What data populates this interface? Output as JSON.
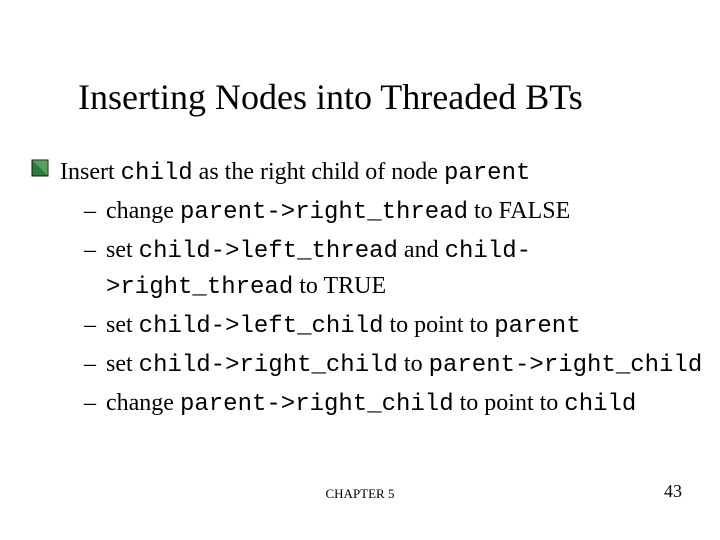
{
  "title": "Inserting Nodes into Threaded BTs",
  "lvl1": {
    "pre": "Insert ",
    "code1": "child",
    "mid": " as the right child of node ",
    "code2": "parent"
  },
  "sub": [
    {
      "pre": "change ",
      "code1": "parent->right_thread",
      "mid": " to FALSE",
      "code2": "",
      "post": ""
    },
    {
      "pre": "set ",
      "code1": "child->left_thread",
      "mid": " and ",
      "code2": "child->right_thread",
      "post": " to TRUE"
    },
    {
      "pre": "set ",
      "code1": "child->left_child",
      "mid": " to point to ",
      "code2": "parent",
      "post": ""
    },
    {
      "pre": "set ",
      "code1": "child->right_child",
      "mid": " to ",
      "code2": "parent->right_child",
      "post": ""
    },
    {
      "pre": "change ",
      "code1": "parent->right_child",
      "mid": " to point to ",
      "code2": "child",
      "post": ""
    }
  ],
  "footer": {
    "center": "CHAPTER 5",
    "right": "43"
  }
}
